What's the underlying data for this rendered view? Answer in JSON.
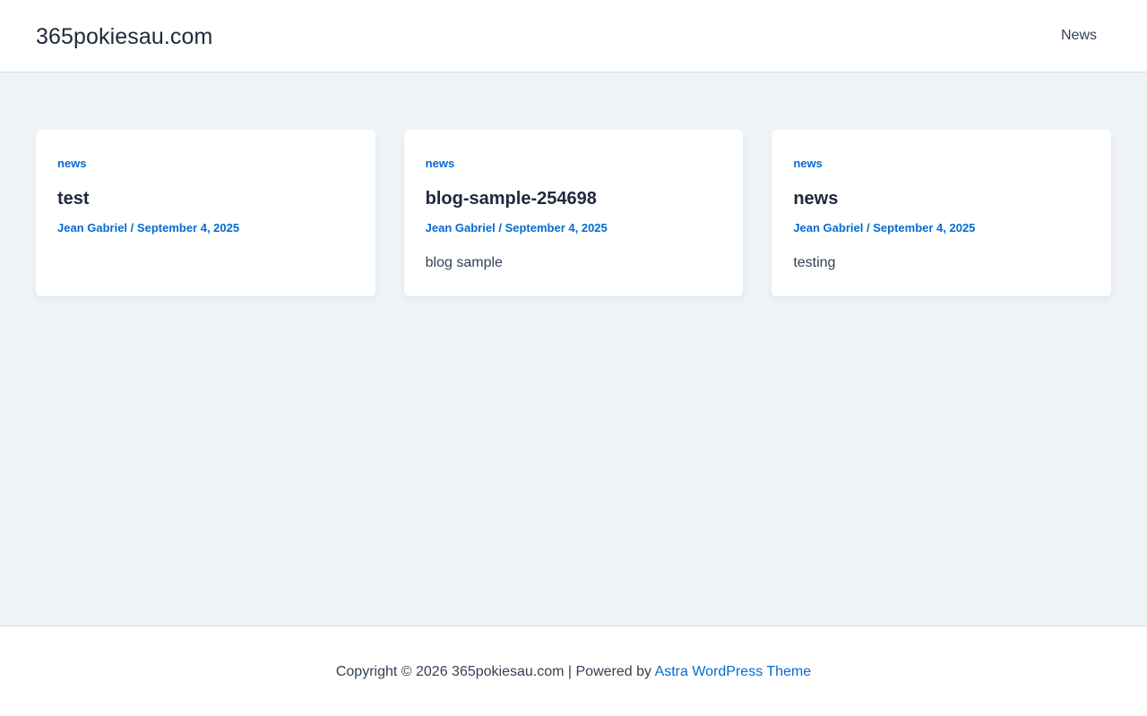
{
  "header": {
    "site_title": "365pokiesau.com",
    "nav_items": [
      {
        "label": "News"
      }
    ]
  },
  "posts": [
    {
      "category": "news",
      "title": "test",
      "author": "Jean Gabriel",
      "separator": "/",
      "date": "September 4, 2025",
      "excerpt": ""
    },
    {
      "category": "news",
      "title": "blog-sample-254698",
      "author": "Jean Gabriel",
      "separator": "/",
      "date": "September 4, 2025",
      "excerpt": "blog sample"
    },
    {
      "category": "news",
      "title": "news",
      "author": "Jean Gabriel",
      "separator": "/",
      "date": "September 4, 2025",
      "excerpt": "testing"
    }
  ],
  "footer": {
    "copyright": "Copyright © 2026 365pokiesau.com | Powered by",
    "theme_link": "Astra WordPress Theme"
  },
  "colors": {
    "accent": "#046bd2",
    "heading": "#1e293b",
    "text": "#334155",
    "page_background": "#eff4f8",
    "surface": "#ffffff"
  }
}
